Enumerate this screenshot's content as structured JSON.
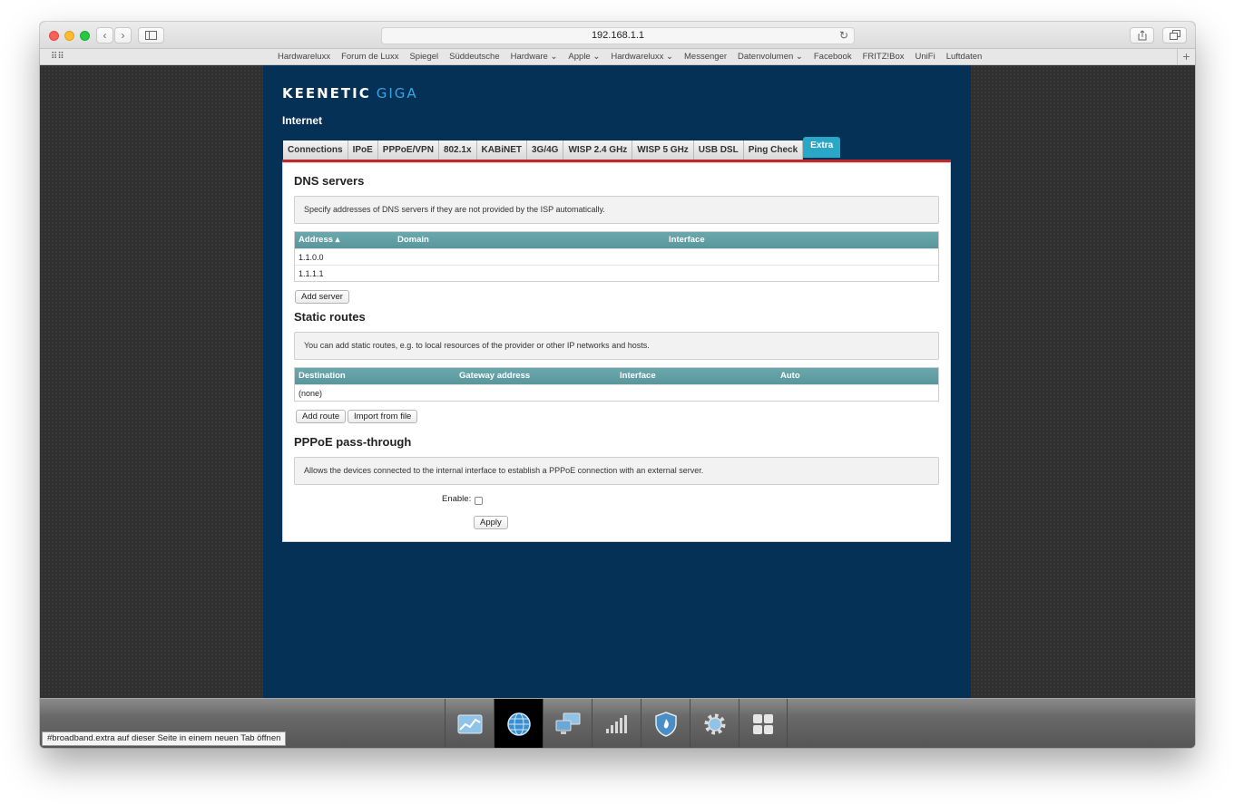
{
  "browser": {
    "url": "192.168.1.1",
    "bookmarks": [
      "Hardwareluxx",
      "Forum de Luxx",
      "Spiegel",
      "Süddeutsche",
      "Hardware ⌄",
      "Apple ⌄",
      "Hardwareluxx ⌄",
      "Messenger",
      "Datenvolumen ⌄",
      "Facebook",
      "FRITZ!Box",
      "UniFi",
      "Luftdaten"
    ],
    "status_hint": "#broadband.extra auf dieser Seite in einem neuen Tab öffnen"
  },
  "brand": {
    "name": "KEENETIC",
    "model": "GIGA"
  },
  "page_title": "Internet",
  "tabs": [
    "Connections",
    "IPoE",
    "PPPoE/VPN",
    "802.1x",
    "KABiNET",
    "3G/4G",
    "WISP 2.4 GHz",
    "WISP 5 GHz",
    "USB DSL",
    "Ping Check",
    "Extra"
  ],
  "active_tab": "Extra",
  "dns": {
    "title": "DNS servers",
    "info": "Specify addresses of DNS servers if they are not provided by the ISP automatically.",
    "columns": [
      "Address ▴",
      "Domain",
      "Interface"
    ],
    "rows": [
      "1.1.0.0",
      "1.1.1.1"
    ],
    "add_button": "Add server"
  },
  "routes": {
    "title": "Static routes",
    "info": "You can add static routes, e.g. to local resources of the provider or other IP networks and hosts.",
    "columns": [
      "Destination",
      "Gateway address",
      "Interface",
      "Auto"
    ],
    "empty": "(none)",
    "add_button": "Add route",
    "import_button": "Import from file"
  },
  "pppoe": {
    "title": "PPPoE pass-through",
    "info": "Allows the devices connected to the internal interface to establish a PPPoE connection with an external server.",
    "enable_label": "Enable:",
    "enabled": false,
    "apply_button": "Apply"
  },
  "dock": [
    "monitor-icon",
    "internet-globe-icon",
    "home-network-icon",
    "wifi-signal-icon",
    "security-shield-icon",
    "settings-gear-icon",
    "apps-grid-icon"
  ],
  "dock_active": "internet-globe-icon"
}
